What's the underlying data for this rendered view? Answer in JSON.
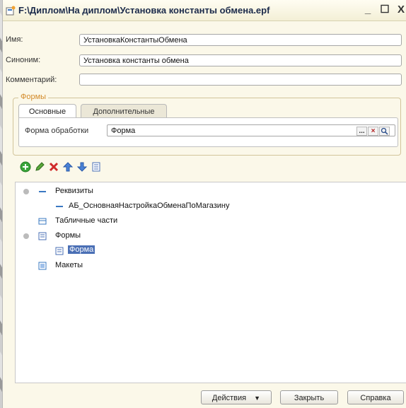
{
  "window": {
    "title": "F:\\Диплом\\На диплом\\Установка константы обмена.epf",
    "minimize": "_",
    "maximize": "☐",
    "close": "X"
  },
  "fields": {
    "name_label": "Имя:",
    "name_value": "УстановкаКонстантыОбмена",
    "synonym_label": "Синоним:",
    "synonym_value": "Установка константы обмена",
    "comment_label": "Комментарий:",
    "comment_value": ""
  },
  "forms_group": {
    "title": "Формы",
    "tabs": [
      {
        "label": "Основные",
        "active": true
      },
      {
        "label": "Дополнительные",
        "active": false
      }
    ],
    "processing_form_label": "Форма обработки",
    "processing_form_value": "Форма",
    "btn_select": "...",
    "btn_clear": "×",
    "btn_open": "🔍"
  },
  "toolbar": {
    "icons": [
      "add-icon",
      "edit-icon",
      "delete-icon",
      "move-up-icon",
      "move-down-icon",
      "list-icon"
    ]
  },
  "tree": {
    "items": [
      {
        "label": "Реквизиты",
        "level": 0,
        "expanded": true
      },
      {
        "label": "АБ_ОсновнаяНастройкаОбменаПоМагазину",
        "level": 1
      },
      {
        "label": "Табличные части",
        "level": 0
      },
      {
        "label": "Формы",
        "level": 0,
        "expanded": true
      },
      {
        "label": "Форма",
        "level": 1,
        "selected": true
      },
      {
        "label": "Макеты",
        "level": 0
      }
    ]
  },
  "buttons": {
    "actions": "Действия",
    "close": "Закрыть",
    "help": "Справка"
  },
  "colors": {
    "background": "#fbf8e9",
    "selection": "#4a6fb5",
    "group_title": "#d38b2a"
  }
}
